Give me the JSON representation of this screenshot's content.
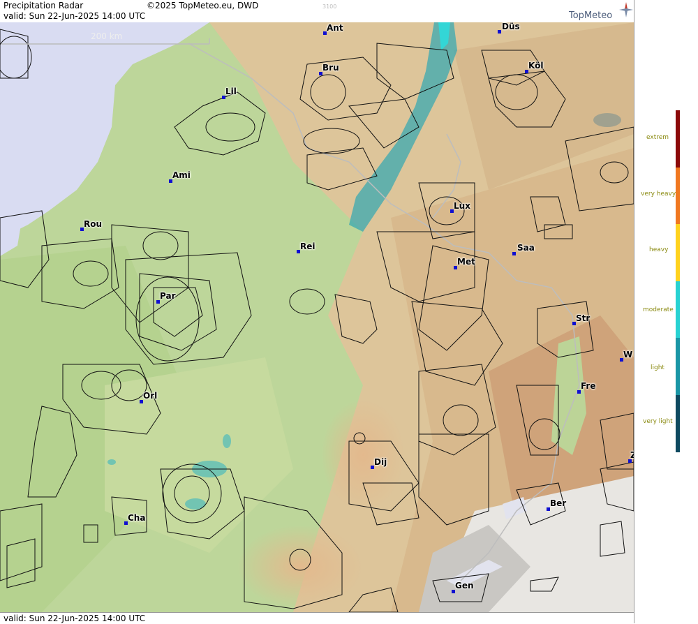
{
  "header": {
    "title": "Precipitation Radar",
    "copyright": "©2025 TopMeteo.eu, DWD",
    "valid": "valid:  Sun  22-Jun-2025 14:00 UTC",
    "code": "3100"
  },
  "logo": {
    "text": "TopMeteo"
  },
  "scale": {
    "label": "200 km"
  },
  "footer": {
    "valid": "valid:  Sun  22-Jun-2025 14:00 UTC"
  },
  "legend": {
    "items": [
      {
        "label": "extrem",
        "color": "#8b0a0a"
      },
      {
        "label": "very heavy",
        "color": "#f07820"
      },
      {
        "label": "heavy",
        "color": "#ffd21e"
      },
      {
        "label": "moderate",
        "color": "#28d2d2"
      },
      {
        "label": "light",
        "color": "#1a96a6"
      },
      {
        "label": "very light",
        "color": "#0f4a60"
      }
    ]
  },
  "cities": [
    {
      "name": "Ant"
    },
    {
      "name": "Düs"
    },
    {
      "name": "Bru"
    },
    {
      "name": "Köl"
    },
    {
      "name": "Lil"
    },
    {
      "name": "Ami"
    },
    {
      "name": "Lux"
    },
    {
      "name": "Rou"
    },
    {
      "name": "Rei"
    },
    {
      "name": "Saa"
    },
    {
      "name": "Met"
    },
    {
      "name": "Par"
    },
    {
      "name": "Str"
    },
    {
      "name": "W"
    },
    {
      "name": "Fre"
    },
    {
      "name": "Orl"
    },
    {
      "name": "Dij"
    },
    {
      "name": "Ber"
    },
    {
      "name": "Cha"
    },
    {
      "name": "Gen"
    },
    {
      "name": "Z"
    }
  ]
}
